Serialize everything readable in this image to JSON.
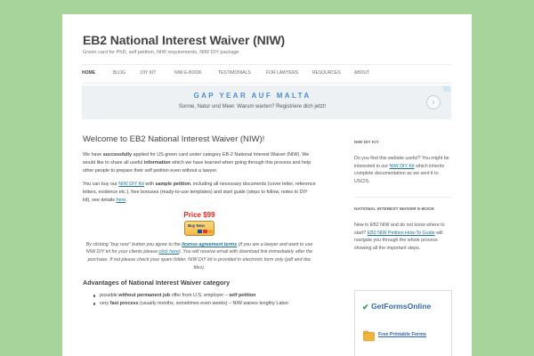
{
  "site": {
    "title": "EB2 National Interest Waiver (NIW)",
    "description": "Green card for PhD, self petition, NIW requirements, NIW DIY package"
  },
  "nav": {
    "items": [
      {
        "label": "Home",
        "active": true
      },
      {
        "label": "Blog"
      },
      {
        "label": "DIY Kit"
      },
      {
        "label": "NIW E-Book"
      },
      {
        "label": "Testimonials"
      },
      {
        "label": "For Lawyers"
      },
      {
        "label": "Resources"
      },
      {
        "label": "About"
      }
    ]
  },
  "ad": {
    "title": "GAP YEAR AUF MALTA",
    "subtitle": "Sonne, Natur und Meer. Warum warten? Registriere dich jetzt!",
    "arrow": "›"
  },
  "main": {
    "title": "Welcome to EB2 National Interest Waiver (NIW)!",
    "p1": {
      "t1": "We have ",
      "b1": "successfully",
      "t2": " applied for US green card under category EB-2 National Interest Waiver (NIW). We would like to share all useful ",
      "b2": "information",
      "t3": " which we have learned when going through this process and help other people to prepare their self petition even without a lawyer."
    },
    "p2": {
      "t1": "You can buy our ",
      "link1": "NIW DIY Kit",
      "t2": " with ",
      "b1": "sample petition",
      "t3": ", including all necessary documents (cover letter, reference letters, evidence etc.), free bonuses (ready-to-use templates) and start guide (steps to follow, notes to DIY kit), see details ",
      "link2": "here",
      "t4": "."
    },
    "price": "Price $99",
    "buy_button": "Buy Now",
    "note": {
      "t1": "By clicking \"buy now\" button you agree to the ",
      "link1": "license agreement terms",
      "t2": " (if you are a lawyer and want to use NIW DIY kit for your clients please ",
      "link2": "click here",
      "t3": "). You will receive email with download link immediately after the purchase. If not please check your spam folder. NIW DIY kit is provided in electronic form only (pdf and doc files)."
    },
    "advantages_title": "Advantages of National Interest Waiver category",
    "advantages": [
      {
        "t1": "possible ",
        "b1": "without permanent job",
        "t2": " offer from U.S. employer – ",
        "b2": "self petition"
      },
      {
        "t1": "very ",
        "b1": "fast process",
        "t2": " (usually months, sometimes even weeks) – NIW waives lengthy Labor",
        "b2": ""
      }
    ]
  },
  "sidebar": {
    "w1": {
      "title": "NIW DIY Kit",
      "t1": "Do you find this website useful? You might be interested in our ",
      "link": "NIW DIY Kit",
      "t2": " which inherits complete documentation as we sent it to USCIS."
    },
    "w2": {
      "title": "National Interest Waiver E-Book",
      "t1": "New in EB2 NIW and do not know where to start? ",
      "link": "EB2 NIW Petition How-To Guide",
      "t2": " will navigate you through the whole process showing all the important steps."
    },
    "gf": {
      "logo": "GetFormsOnline",
      "link": "Free Printable Forms"
    }
  },
  "colors": {
    "background": "#a6d49a",
    "link": "#21759b",
    "price": "#e8231e",
    "ad_title": "#4a8fd0"
  }
}
